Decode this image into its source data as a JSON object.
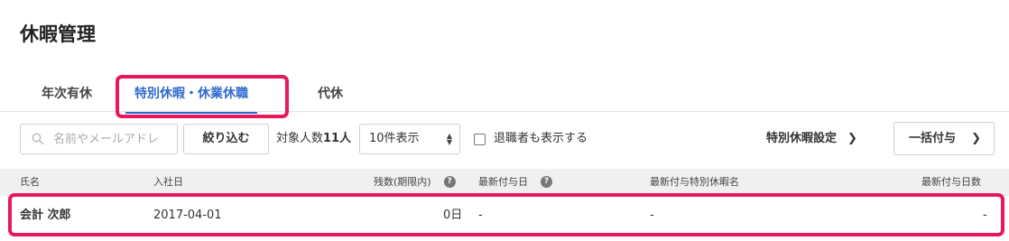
{
  "page": {
    "title": "休暇管理"
  },
  "tabs": [
    {
      "label": "年次有休",
      "active": false
    },
    {
      "label": "特別休暇・休業休職",
      "active": true
    },
    {
      "label": "代休",
      "active": false
    }
  ],
  "toolbar": {
    "search_placeholder": "名前やメールアドレ",
    "filter_button": "絞り込む",
    "count_label": "対象人数",
    "count_value": "11人",
    "page_size_selected": "10件表示",
    "show_retired_label": "退職者も表示する",
    "show_retired_checked": false,
    "settings_link": "特別休暇設定",
    "grant_button": "一括付与"
  },
  "table": {
    "columns": [
      "氏名",
      "入社日",
      "残数(期限内)",
      "最新付与日",
      "最新付与特別休暇名",
      "最新付与日数"
    ],
    "rows": [
      {
        "name": "会計 次郎",
        "hire_date": "2017-04-01",
        "remaining": "0日",
        "last_grant_date": "-",
        "last_grant_leave_name": "-",
        "last_grant_days": "-"
      }
    ]
  },
  "icons": {
    "search": "search-icon",
    "chevron": "chevron-right-icon",
    "help": "question-circle-icon",
    "select_arrows": "updown-arrows-icon"
  },
  "colors": {
    "accent": "#2f6ad0",
    "highlight": "#e8185a",
    "header_bg": "#f0f0f0"
  }
}
